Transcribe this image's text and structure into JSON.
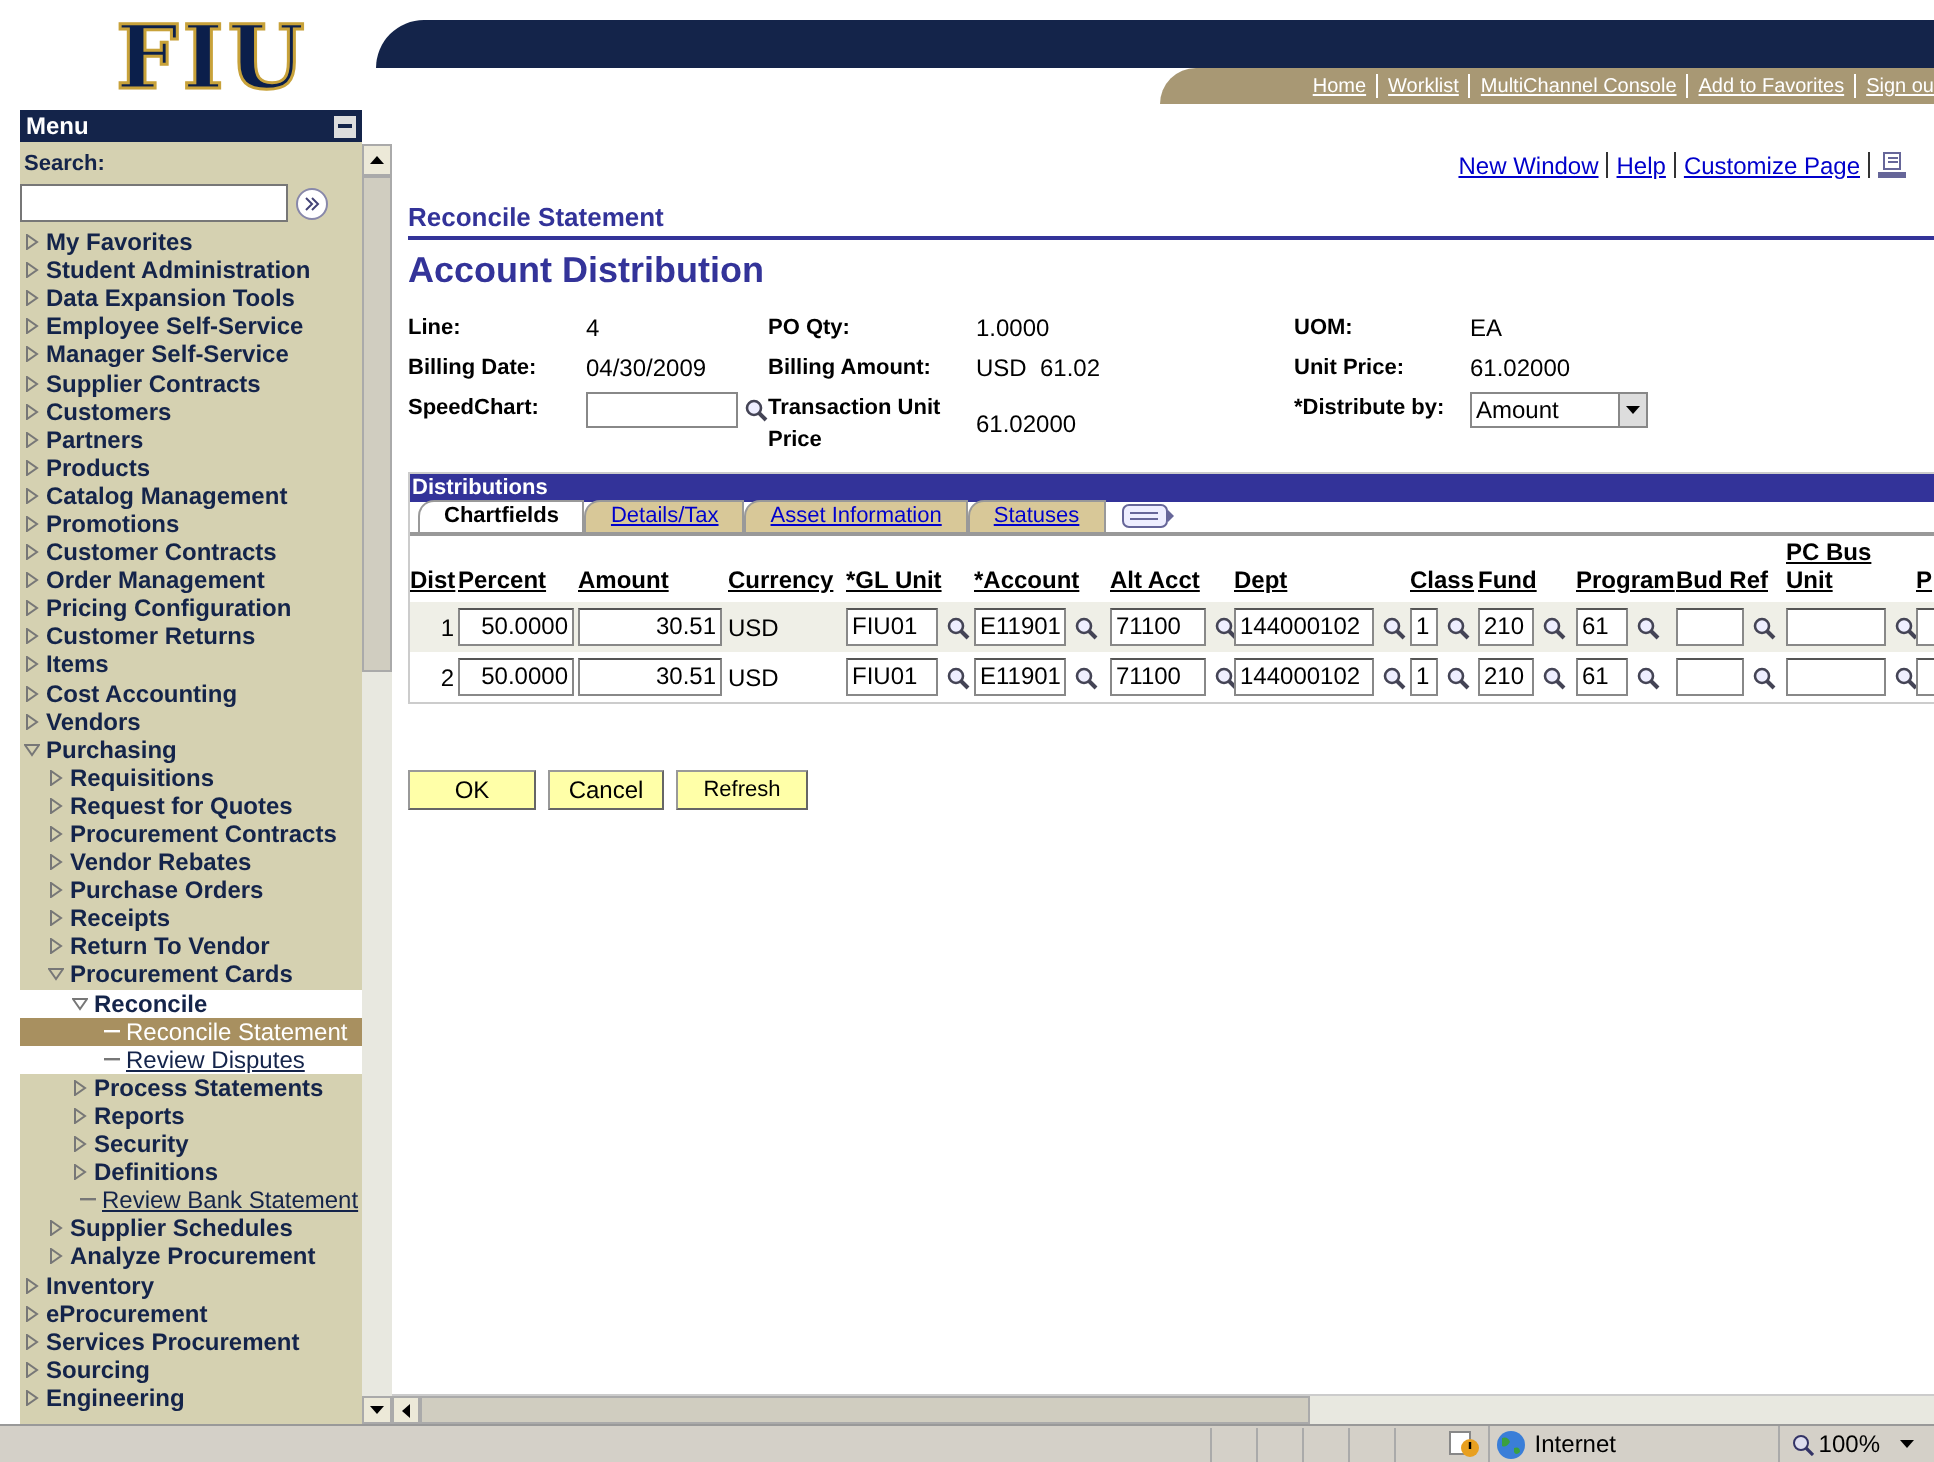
{
  "header": {
    "logo": "FIU",
    "links": [
      "Home",
      "Worklist",
      "MultiChannel Console",
      "Add to Favorites",
      "Sign ou"
    ]
  },
  "menu": {
    "title": "Menu",
    "search_label": "Search:",
    "items": [
      {
        "label": "My Favorites",
        "kind": "folder",
        "expanded": false
      },
      {
        "label": "Student Administration",
        "kind": "folder",
        "expanded": false
      },
      {
        "label": "Data Expansion Tools",
        "kind": "folder",
        "expanded": false
      },
      {
        "label": "Employee Self-Service",
        "kind": "folder",
        "expanded": false
      },
      {
        "label": "Manager Self-Service",
        "kind": "folder",
        "expanded": false
      },
      {
        "label": "Supplier Contracts",
        "kind": "folder",
        "expanded": false
      },
      {
        "label": "Customers",
        "kind": "folder",
        "expanded": false
      },
      {
        "label": "Partners",
        "kind": "folder",
        "expanded": false
      },
      {
        "label": "Products",
        "kind": "folder",
        "expanded": false
      },
      {
        "label": "Catalog Management",
        "kind": "folder",
        "expanded": false
      },
      {
        "label": "Promotions",
        "kind": "folder",
        "expanded": false
      },
      {
        "label": "Customer Contracts",
        "kind": "folder",
        "expanded": false
      },
      {
        "label": "Order Management",
        "kind": "folder",
        "expanded": false
      },
      {
        "label": "Pricing Configuration",
        "kind": "folder",
        "expanded": false
      },
      {
        "label": "Customer Returns",
        "kind": "folder",
        "expanded": false
      },
      {
        "label": "Items",
        "kind": "folder",
        "expanded": false
      },
      {
        "label": "Cost Accounting",
        "kind": "folder",
        "expanded": false
      },
      {
        "label": "Vendors",
        "kind": "folder",
        "expanded": false
      },
      {
        "label": "Purchasing",
        "kind": "folder",
        "expanded": true,
        "children": [
          {
            "label": "Requisitions",
            "kind": "folder",
            "expanded": false
          },
          {
            "label": "Request for Quotes",
            "kind": "folder",
            "expanded": false
          },
          {
            "label": "Procurement Contracts",
            "kind": "folder",
            "expanded": false
          },
          {
            "label": "Vendor Rebates",
            "kind": "folder",
            "expanded": false
          },
          {
            "label": "Purchase Orders",
            "kind": "folder",
            "expanded": false
          },
          {
            "label": "Receipts",
            "kind": "folder",
            "expanded": false
          },
          {
            "label": "Return To Vendor",
            "kind": "folder",
            "expanded": false
          },
          {
            "label": "Procurement Cards",
            "kind": "folder",
            "expanded": true,
            "children": [
              {
                "label": "Reconcile",
                "kind": "folder",
                "expanded": true,
                "current": true,
                "children": [
                  {
                    "label": "Reconcile Statement",
                    "kind": "link",
                    "selected": true,
                    "current": true
                  },
                  {
                    "label": "Review Disputes",
                    "kind": "link",
                    "selected": false,
                    "current": true
                  }
                ]
              },
              {
                "label": "Process Statements",
                "kind": "folder",
                "expanded": false
              },
              {
                "label": "Reports",
                "kind": "folder",
                "expanded": false
              },
              {
                "label": "Security",
                "kind": "folder",
                "expanded": false
              },
              {
                "label": "Definitions",
                "kind": "folder",
                "expanded": false
              },
              {
                "label": "Review Bank Statement",
                "kind": "link",
                "selected": false,
                "current": false
              }
            ]
          },
          {
            "label": "Supplier Schedules",
            "kind": "folder",
            "expanded": false
          },
          {
            "label": "Analyze Procurement",
            "kind": "folder",
            "expanded": false
          }
        ]
      },
      {
        "label": "Inventory",
        "kind": "folder",
        "expanded": false
      },
      {
        "label": "eProcurement",
        "kind": "folder",
        "expanded": false
      },
      {
        "label": "Services Procurement",
        "kind": "folder",
        "expanded": false
      },
      {
        "label": "Sourcing",
        "kind": "folder",
        "expanded": false
      },
      {
        "label": "Engineering",
        "kind": "folder",
        "expanded": false
      }
    ]
  },
  "page_links": [
    "New Window",
    "Help",
    "Customize Page"
  ],
  "breadcrumb": "Reconcile Statement",
  "title": "Account Distribution",
  "fields": [
    {
      "label": "Line:",
      "kind": "text",
      "value": "4"
    },
    {
      "label": "PO Qty:",
      "kind": "text",
      "value": "1.0000"
    },
    {
      "label": "UOM:",
      "kind": "text",
      "value": "EA"
    },
    {
      "label": "Billing Date:",
      "kind": "text",
      "value": "04/30/2009"
    },
    {
      "label": "Billing Amount:",
      "kind": "text",
      "value": "USD  61.02"
    },
    {
      "label": "Unit Price:",
      "kind": "text",
      "value": "61.02000"
    },
    {
      "label": "SpeedChart:",
      "kind": "lookup"
    },
    {
      "label": "Transaction Unit Price",
      "kind": "text",
      "value": "61.02000"
    },
    {
      "label": "*Distribute by:",
      "kind": "select",
      "value": "Amount"
    }
  ],
  "distributions": {
    "title": "Distributions",
    "tabs": [
      {
        "label": "Chartfields",
        "selected": true
      },
      {
        "label": "Details/Tax",
        "selected": false
      },
      {
        "label": "Asset Information",
        "selected": false
      },
      {
        "label": "Statuses",
        "selected": false
      }
    ],
    "columns": [
      "Dist",
      "Percent",
      "Amount",
      "Currency",
      "*GL Unit",
      "*Account",
      "Alt Acct",
      "Dept",
      "Class",
      "Fund",
      "Program",
      "Bud Ref",
      "PC Bus Unit",
      "P"
    ],
    "rows": [
      [
        {
          "kind": "text",
          "value": "1"
        },
        {
          "kind": "input",
          "value": "50.0000"
        },
        {
          "kind": "input",
          "value": "30.51"
        },
        {
          "kind": "text",
          "value": "USD"
        },
        {
          "kind": "lookup",
          "value": "FIU01"
        },
        {
          "kind": "lookup",
          "value": "E11901"
        },
        {
          "kind": "lookup",
          "value": "71100"
        },
        {
          "kind": "lookup",
          "value": "144000102"
        },
        {
          "kind": "lookup",
          "value": "1"
        },
        {
          "kind": "lookup",
          "value": "210"
        },
        {
          "kind": "lookup",
          "value": "61"
        },
        {
          "kind": "lookup"
        },
        {
          "kind": "lookup"
        },
        {
          "kind": "input"
        }
      ],
      [
        {
          "kind": "text",
          "value": "2"
        },
        {
          "kind": "input",
          "value": "50.0000"
        },
        {
          "kind": "input",
          "value": "30.51"
        },
        {
          "kind": "text",
          "value": "USD"
        },
        {
          "kind": "lookup",
          "value": "FIU01"
        },
        {
          "kind": "lookup",
          "value": "E11901"
        },
        {
          "kind": "lookup",
          "value": "71100"
        },
        {
          "kind": "lookup",
          "value": "144000102"
        },
        {
          "kind": "lookup",
          "value": "1"
        },
        {
          "kind": "lookup",
          "value": "210"
        },
        {
          "kind": "lookup",
          "value": "61"
        },
        {
          "kind": "lookup"
        },
        {
          "kind": "lookup"
        },
        {
          "kind": "input"
        }
      ]
    ]
  },
  "buttons": [
    "OK",
    "Cancel",
    "Refresh"
  ],
  "status_bar": {
    "zone": "Internet",
    "zoom": "100%"
  }
}
